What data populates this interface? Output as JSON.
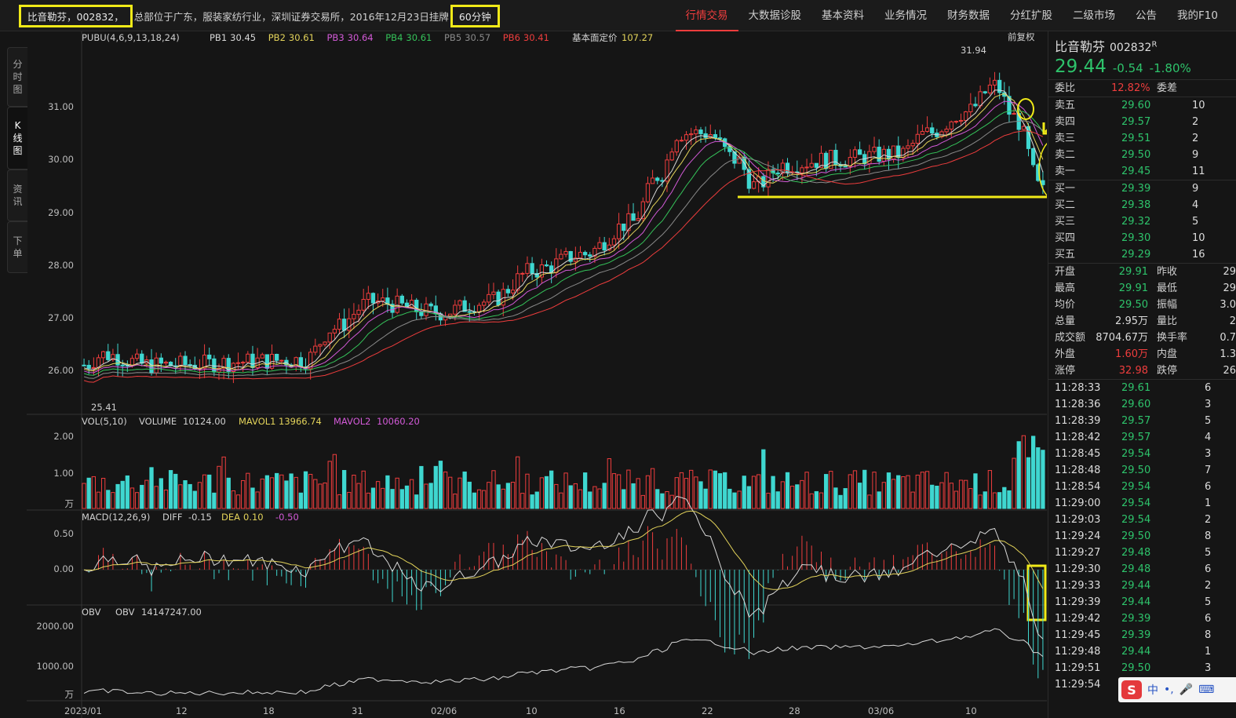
{
  "header": {
    "stock_name_code": "比音勒芬，002832，",
    "description": "总部位于广东，服装家纺行业，深圳证券交易所，2016年12月23日挂牌",
    "period": "60分钟"
  },
  "nav": [
    "行情交易",
    "大数据诊股",
    "基本资料",
    "业务情况",
    "财务数据",
    "分红扩股",
    "二级市场",
    "公告",
    "我的F10"
  ],
  "sidebar": [
    "分时图",
    "K线图",
    "资讯",
    "下单"
  ],
  "chart": {
    "pubu": {
      "title": "PUBU(4,6,9,13,18,24)",
      "items": [
        {
          "label": "PB1",
          "value": "30.45",
          "color": "#d8d8d8"
        },
        {
          "label": "PB2",
          "value": "30.61",
          "color": "#e3d35a"
        },
        {
          "label": "PB3",
          "value": "30.64",
          "color": "#d35ad8"
        },
        {
          "label": "PB4",
          "value": "30.61",
          "color": "#35c35a"
        },
        {
          "label": "PB5",
          "value": "30.57",
          "color": "#8a8a8a"
        },
        {
          "label": "PB6",
          "value": "30.41",
          "color": "#ee3d3d"
        }
      ],
      "fundamental_label": "基本面定价",
      "fundamental_value": "107.27",
      "adjust": "前复权",
      "y_ticks": [
        "31.00",
        "30.00",
        "29.00",
        "28.00",
        "27.00",
        "26.00"
      ],
      "y_values": [
        31,
        30,
        29,
        28,
        27,
        26
      ],
      "high_label": "31.94",
      "low_label": "25.41"
    },
    "volume": {
      "title": "VOL(5,10)",
      "volume_label": "VOLUME",
      "volume_value": "10124.00",
      "mavol1_label": "MAVOL1",
      "mavol1_value": "13966.74",
      "mavol2_label": "MAVOL2",
      "mavol2_value": "10060.20",
      "y_ticks": [
        "2.00",
        "1.00",
        "万"
      ]
    },
    "macd": {
      "title": "MACD(12,26,9)",
      "diff_label": "DIFF",
      "diff_value": "-0.15",
      "dea_label": "DEA",
      "dea_value": "0.10",
      "macd_value": "-0.50",
      "y_ticks": [
        "0.50",
        "0.00"
      ]
    },
    "obv": {
      "title": "OBV",
      "obv_label": "OBV",
      "obv_value": "14147247.00",
      "y_ticks": [
        "2000.00",
        "1000.00",
        "万"
      ]
    },
    "x_ticks": [
      "2023/01",
      "12",
      "18",
      "31",
      "02/06",
      "10",
      "16",
      "22",
      "28",
      "03/06",
      "10"
    ]
  },
  "quote": {
    "name": "比音勒芬",
    "code": "002832",
    "code_suffix": "R",
    "price": "29.44",
    "change": "-0.54",
    "change_pct": "-1.80%",
    "weibi_label": "委比",
    "weibi_value": "12.82%",
    "weicha_label": "委差",
    "asks": [
      {
        "label": "卖五",
        "price": "29.60",
        "vol": "10"
      },
      {
        "label": "卖四",
        "price": "29.57",
        "vol": "2"
      },
      {
        "label": "卖三",
        "price": "29.51",
        "vol": "2"
      },
      {
        "label": "卖二",
        "price": "29.50",
        "vol": "9"
      },
      {
        "label": "卖一",
        "price": "29.45",
        "vol": "11"
      }
    ],
    "bids": [
      {
        "label": "买一",
        "price": "29.39",
        "vol": "9"
      },
      {
        "label": "买二",
        "price": "29.38",
        "vol": "4"
      },
      {
        "label": "买三",
        "price": "29.32",
        "vol": "5"
      },
      {
        "label": "买四",
        "price": "29.30",
        "vol": "10"
      },
      {
        "label": "买五",
        "price": "29.29",
        "vol": "16"
      }
    ],
    "stats": [
      {
        "l1": "开盘",
        "v1": "29.91",
        "c1": "green",
        "l2": "昨收",
        "v2": "29"
      },
      {
        "l1": "最高",
        "v1": "29.91",
        "c1": "green",
        "l2": "最低",
        "v2": "29"
      },
      {
        "l1": "均价",
        "v1": "29.50",
        "c1": "green",
        "l2": "振幅",
        "v2": "3.0"
      },
      {
        "l1": "总量",
        "v1": "2.95万",
        "c1": "white",
        "l2": "量比",
        "v2": "2"
      },
      {
        "l1": "成交额",
        "v1": "8704.67万",
        "c1": "white",
        "l2": "换手率",
        "v2": "0.7"
      },
      {
        "l1": "外盘",
        "v1": "1.60万",
        "c1": "red",
        "l2": "内盘",
        "v2": "1.3"
      },
      {
        "l1": "涨停",
        "v1": "32.98",
        "c1": "red",
        "l2": "跌停",
        "v2": "26"
      }
    ],
    "ticks": [
      {
        "time": "11:28:33",
        "price": "29.61",
        "vol": "6"
      },
      {
        "time": "11:28:36",
        "price": "29.60",
        "vol": "3"
      },
      {
        "time": "11:28:39",
        "price": "29.57",
        "vol": "5"
      },
      {
        "time": "11:28:42",
        "price": "29.57",
        "vol": "4"
      },
      {
        "time": "11:28:45",
        "price": "29.54",
        "vol": "3"
      },
      {
        "time": "11:28:48",
        "price": "29.50",
        "vol": "7"
      },
      {
        "time": "11:28:54",
        "price": "29.54",
        "vol": "6"
      },
      {
        "time": "11:29:00",
        "price": "29.54",
        "vol": "1"
      },
      {
        "time": "11:29:03",
        "price": "29.54",
        "vol": "2"
      },
      {
        "time": "11:29:24",
        "price": "29.50",
        "vol": "8"
      },
      {
        "time": "11:29:27",
        "price": "29.48",
        "vol": "5"
      },
      {
        "time": "11:29:30",
        "price": "29.48",
        "vol": "6"
      },
      {
        "time": "11:29:33",
        "price": "29.44",
        "vol": "2"
      },
      {
        "time": "11:29:39",
        "price": "29.44",
        "vol": "5"
      },
      {
        "time": "11:29:42",
        "price": "29.39",
        "vol": "6"
      },
      {
        "time": "11:29:45",
        "price": "29.39",
        "vol": "8"
      },
      {
        "time": "11:29:48",
        "price": "29.44",
        "vol": "1"
      },
      {
        "time": "11:29:51",
        "price": "29.50",
        "vol": "3"
      },
      {
        "time": "11:29:54",
        "price": "",
        "vol": ""
      }
    ]
  },
  "ime": {
    "logo": "S",
    "lang": "中"
  },
  "colors": {
    "up": "#ee3d3d",
    "down": "#3fd7d0",
    "accent": "#f1ea18",
    "price": "#2ec36b"
  }
}
